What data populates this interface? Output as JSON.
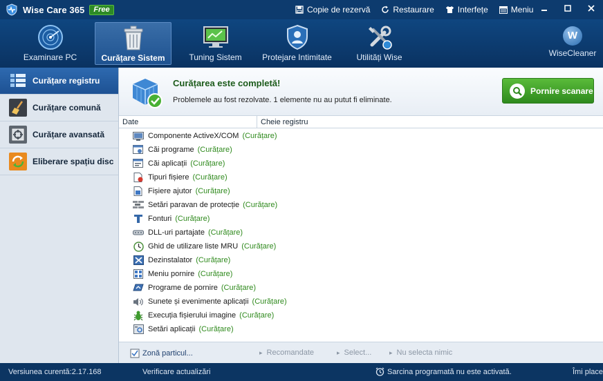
{
  "titlebar": {
    "app_name": "Wise Care 365",
    "badge": "Free",
    "actions": [
      {
        "label": "Copie de rezervă",
        "icon": "backup-icon"
      },
      {
        "label": "Restaurare",
        "icon": "restore-icon"
      },
      {
        "label": "Interfețe",
        "icon": "skin-icon"
      },
      {
        "label": "Meniu",
        "icon": "menu-icon"
      }
    ]
  },
  "toolbar": {
    "tabs": [
      {
        "label": "Examinare PC",
        "icon": "radar-icon"
      },
      {
        "label": "Curățare Sistem",
        "icon": "trash-can-icon"
      },
      {
        "label": "Tuning Sistem",
        "icon": "monitor-icon"
      },
      {
        "label": "Protejare Intimitate",
        "icon": "shield-icon"
      },
      {
        "label": "Utilități Wise",
        "icon": "tools-icon"
      }
    ],
    "active_tab": "Curățare Sistem",
    "brand": {
      "letter": "W",
      "name": "WiseCleaner"
    }
  },
  "sidebar": {
    "items": [
      {
        "label": "Curățare registru",
        "icon": "registry-icon"
      },
      {
        "label": "Curățare comună",
        "icon": "broom-icon"
      },
      {
        "label": "Curățare avansată",
        "icon": "advanced-clean-icon"
      },
      {
        "label": "Eliberare spațiu disc",
        "icon": "disk-icon"
      }
    ],
    "active": "Curățare registru"
  },
  "banner": {
    "title": "Curățarea este completă!",
    "subtitle": "Problemele au fost rezolvate. 1 elemente nu au putut fi eliminate.",
    "scan_button": "Pornire scanare"
  },
  "columns": {
    "date": "Date",
    "key": "Cheie registru"
  },
  "items": [
    {
      "label": "Componente ActiveX/COM",
      "status": "(Curățare)",
      "icon": "activex-icon"
    },
    {
      "label": "Căi programe",
      "status": "(Curățare)",
      "icon": "program-path-icon"
    },
    {
      "label": "Căi aplicații",
      "status": "(Curățare)",
      "icon": "app-path-icon"
    },
    {
      "label": "Tipuri fișiere",
      "status": "(Curățare)",
      "icon": "file-type-icon"
    },
    {
      "label": "Fișiere ajutor",
      "status": "(Curățare)",
      "icon": "help-file-icon"
    },
    {
      "label": "Setări paravan de protecție",
      "status": "(Curățare)",
      "icon": "firewall-icon"
    },
    {
      "label": "Fonturi",
      "status": "(Curățare)",
      "icon": "font-icon"
    },
    {
      "label": "DLL-uri partajate",
      "status": "(Curățare)",
      "icon": "dll-icon"
    },
    {
      "label": "Ghid de utilizare liste MRU",
      "status": "(Curățare)",
      "icon": "mru-icon"
    },
    {
      "label": "Dezinstalator",
      "status": "(Curățare)",
      "icon": "uninstaller-icon"
    },
    {
      "label": "Meniu pornire",
      "status": "(Curățare)",
      "icon": "start-menu-icon"
    },
    {
      "label": "Programe de pornire",
      "status": "(Curățare)",
      "icon": "startup-icon"
    },
    {
      "label": "Sunete și evenimente aplicații",
      "status": "(Curățare)",
      "icon": "sound-icon"
    },
    {
      "label": "Execuția fișierului imagine",
      "status": "(Curățare)",
      "icon": "bug-icon"
    },
    {
      "label": "Setări aplicații",
      "status": "(Curățare)",
      "icon": "app-settings-icon"
    }
  ],
  "bottombar": {
    "custom": "Zonă particul...",
    "recommended": "Recomandate",
    "select": "Select...",
    "select_none": "Nu selecta nimic"
  },
  "statusbar": {
    "version": "Versiunea curentă:2.17.168",
    "check_updates": "Verificare actualizări",
    "task": "Sarcina programată nu este activată.",
    "like": "Îmi place"
  },
  "colors": {
    "titlebar": "#0d3b6e",
    "active_sidebar": "#2e6ab0",
    "clean_text": "#2f8a1d",
    "scan_button": "#3e9f29"
  }
}
